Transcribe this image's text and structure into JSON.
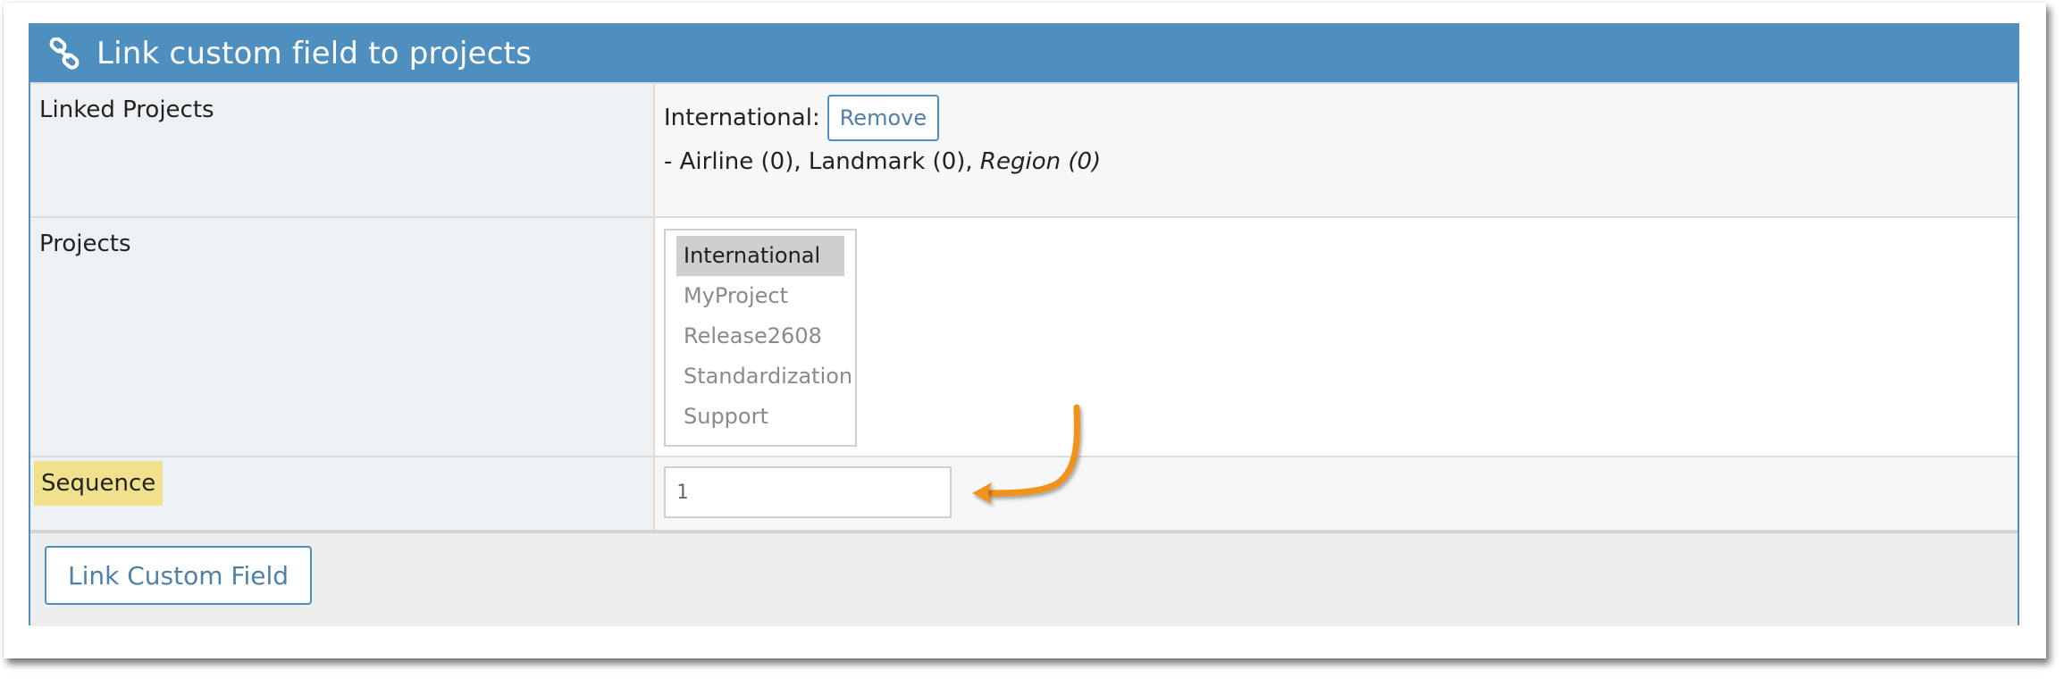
{
  "header": {
    "title": "Link custom field to projects",
    "icon": "link-icon"
  },
  "linked_projects": {
    "label": "Linked Projects",
    "project_name": "International:",
    "remove_label": "Remove",
    "fields_prefix": "- Airline (0), Landmark (0), ",
    "fields_italic": "Region (0)"
  },
  "projects": {
    "label": "Projects",
    "options": [
      "International",
      "MyProject",
      "Release2608",
      "Standardization",
      "Support"
    ],
    "selected": "International"
  },
  "sequence": {
    "label": "Sequence",
    "value": "1"
  },
  "footer": {
    "submit_label": "Link Custom Field"
  },
  "annotation": {
    "arrow_color": "#f0921e"
  },
  "colors": {
    "accent": "#4f8fc0",
    "highlight": "#f1e18c"
  }
}
